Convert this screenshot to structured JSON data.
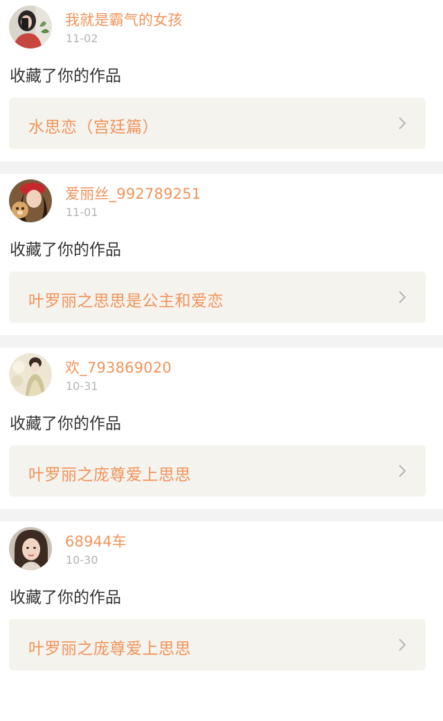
{
  "feed": [
    {
      "username": "我就是霸气的女孩",
      "date": "11-02",
      "action": "收藏了你的作品",
      "work_title": "水思恋（宫廷篇）",
      "avatar_icon": "user-avatar-photo"
    },
    {
      "username": "爱丽丝_992789251",
      "date": "11-01",
      "action": "收藏了你的作品",
      "work_title": "叶罗丽之思思是公主和爱恋",
      "avatar_icon": "user-avatar-photo"
    },
    {
      "username": "欢_793869020",
      "date": "10-31",
      "action": "收藏了你的作品",
      "work_title": "叶罗丽之庞尊爱上思思",
      "avatar_icon": "user-avatar-photo"
    },
    {
      "username": "68944车",
      "date": "10-30",
      "action": "收藏了你的作品",
      "work_title": "叶罗丽之庞尊爱上思思",
      "avatar_icon": "user-avatar-photo"
    }
  ],
  "colors": {
    "accent": "#f0935a",
    "date_gray": "#b3b3b3",
    "card_bg": "#f4f3ee",
    "divider": "#f3f3f3",
    "text": "#333333"
  },
  "icons": {
    "chevron": "chevron-right-icon"
  }
}
